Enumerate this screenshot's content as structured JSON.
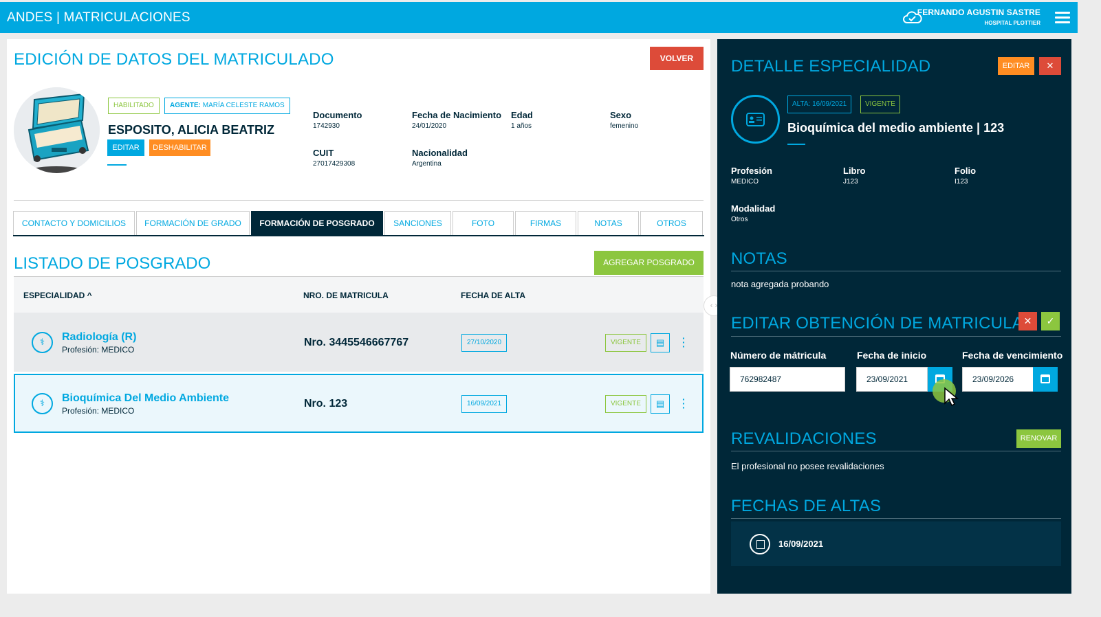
{
  "header": {
    "app_title": "ANDES | MATRICULACIONES",
    "user_name": "FERNANDO AGUSTIN SASTRE",
    "user_org": "HOSPITAL PLOTTIER"
  },
  "left": {
    "title": "EDICIÓN DE DATOS DEL MATRICULADO",
    "volver": "VOLVER",
    "tag_habilitado": "HABILITADO",
    "agente_label": "AGENTE:",
    "agente_value": "MARÍA CELESTE RAMOS",
    "person_name": "ESPOSITO, ALICIA BEATRIZ",
    "btn_editar": "EDITAR",
    "btn_deshabilitar": "DESHABILITAR",
    "fields": {
      "documento": {
        "label": "Documento",
        "value": "1742930"
      },
      "nacimiento": {
        "label": "Fecha de Nacimiento",
        "value": "24/01/2020"
      },
      "edad": {
        "label": "Edad",
        "value": "1 años"
      },
      "sexo": {
        "label": "Sexo",
        "value": "femenino"
      },
      "cuit": {
        "label": "CUIT",
        "value": "27017429308"
      },
      "nacionalidad": {
        "label": "Nacionalidad",
        "value": "Argentina"
      }
    },
    "tabs": [
      {
        "label": "CONTACTO Y DOMICILIOS"
      },
      {
        "label": "FORMACIÓN DE GRADO"
      },
      {
        "label": "FORMACIÓN DE POSGRADO"
      },
      {
        "label": "SANCIONES"
      },
      {
        "label": "FOTO"
      },
      {
        "label": "FIRMAS"
      },
      {
        "label": "NOTAS"
      },
      {
        "label": "OTROS"
      }
    ],
    "list_title": "LISTADO DE POSGRADO",
    "btn_agregar": "AGREGAR POSGRADO",
    "columns": {
      "especialidad": "ESPECIALIDAD ^",
      "matricula": "NRO. DE MATRICULA",
      "fecha": "FECHA DE ALTA"
    },
    "rows": [
      {
        "especialidad": "Radiología (R)",
        "profesion": "Profesión: MEDICO",
        "nro": "Nro. 3445546667767",
        "fecha": "27/10/2020",
        "estado": "VIGENTE"
      },
      {
        "especialidad": "Bioquímica Del Medio Ambiente",
        "profesion": "Profesión: MEDICO",
        "nro": "Nro. 123",
        "fecha": "16/09/2021",
        "estado": "VIGENTE"
      }
    ]
  },
  "right": {
    "title": "DETALLE ESPECIALIDAD",
    "btn_editar": "EDITAR",
    "close_glyph": "✕",
    "tag_alta": "ALTA: 16/09/2021",
    "tag_vigente": "VIGENTE",
    "especialidad": "Bioquímica del medio ambiente | 123",
    "profesion": {
      "label": "Profesión",
      "value": "MEDICO"
    },
    "libro": {
      "label": "Libro",
      "value": "J123"
    },
    "folio": {
      "label": "Folio",
      "value": "I123"
    },
    "modalidad": {
      "label": "Modalidad",
      "value": "Otros"
    },
    "notas_title": "NOTAS",
    "notas_text": "nota agregada probando",
    "editar_title": "EDITAR OBTENCIÓN DE MATRICULA",
    "numero_label": "Número de mátricula",
    "numero_value": "762982487",
    "inicio_label": "Fecha de inicio",
    "inicio_value": "23/09/2021",
    "venc_label": "Fecha de vencimiento",
    "venc_value": "23/09/2026",
    "reval_title": "REVALIDACIONES",
    "btn_renovar": "RENOVAR",
    "reval_text": "El profesional no posee revalidaciones",
    "altas_title": "FECHAS DE ALTAS",
    "alta_fecha": "16/09/2021"
  },
  "colors": {
    "brand": "#00a8e0",
    "dark": "#002738",
    "success": "#8cc63f",
    "warning": "#ff8d22",
    "danger": "#dd4b39"
  }
}
